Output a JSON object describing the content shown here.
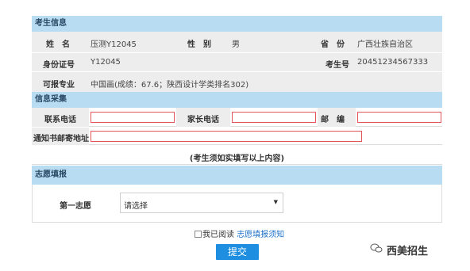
{
  "sections": {
    "info": "考生信息",
    "collect": "信息采集",
    "wish": "志愿填报"
  },
  "info": {
    "name_label": "姓　名",
    "name_value": "压测Y12045",
    "gender_label": "性　别",
    "gender_value": "男",
    "province_label": "省　份",
    "province_value": "广西壮族自治区",
    "id_label": "身份证号",
    "id_value": "Y12045",
    "exam_no_label": "考生号",
    "exam_no_value": "20451234567333",
    "major_label": "可报专业",
    "major_value": "中国画(成绩：67.6；陕西设计学类排名302)"
  },
  "collect": {
    "phone_label": "联系电话",
    "phone_value": "",
    "parent_phone_label": "家长电话",
    "parent_phone_value": "",
    "zip_label": "邮　编",
    "zip_value": "",
    "address_label": "通知书邮寄地址",
    "address_value": "",
    "notice": "(考生须如实填写以上内容)"
  },
  "wish": {
    "first_label": "第一志愿",
    "select_value": "请选择"
  },
  "agree": {
    "prefix": "我已阅读",
    "link": "志愿填报须知",
    "checked": false
  },
  "submit_label": "提交",
  "watermark": "西美招生",
  "colors": {
    "section_bg": "#b8dcf2",
    "row_gray": "#ededed",
    "input_border": "#e0555a",
    "button": "#1e8fe0",
    "link": "#1e72c8"
  }
}
